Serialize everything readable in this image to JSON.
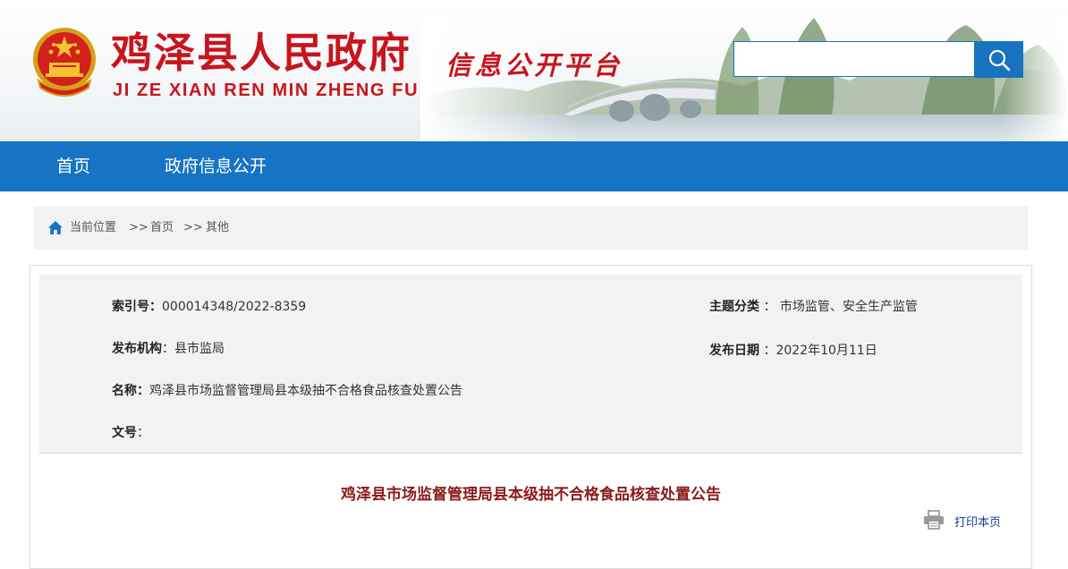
{
  "header": {
    "site_name": "鸡泽县人民政府",
    "site_pinyin": "JI ZE XIAN REN MIN ZHENG FU",
    "platform_name": "信息公开平台",
    "search": {
      "value": "",
      "placeholder": ""
    },
    "icons": {
      "emblem": "national-emblem-icon",
      "search": "search-icon"
    }
  },
  "nav": {
    "items": [
      {
        "label": "首页"
      },
      {
        "label": "政府信息公开"
      }
    ]
  },
  "breadcrumb": {
    "current_label": "当前位置",
    "separator": ">>",
    "items": [
      "首页",
      "其他"
    ],
    "icon": "home-icon"
  },
  "meta": {
    "index_label": "索引号",
    "index_value": "000014348/2022-8359",
    "topic_label": "主题分类",
    "topic_value": "市场监管、安全生产监管",
    "publisher_label": "发布机构",
    "publisher_value": "县市监局",
    "date_label": "发布日期",
    "date_value": "2022年10月11日",
    "name_label": "名称",
    "name_value": "鸡泽县市场监督管理局县本级抽不合格食品核查处置公告",
    "docno_label": "文号",
    "docno_value": ""
  },
  "article": {
    "title": "鸡泽县市场监督管理局县本级抽不合格食品核查处置公告",
    "print_label": "打印本页",
    "print_icon": "printer-icon"
  },
  "colors": {
    "brand_red": "#c8151d",
    "nav_blue": "#1774c4",
    "title_red": "#8b1a1a",
    "link_blue": "#1a3a9c"
  }
}
